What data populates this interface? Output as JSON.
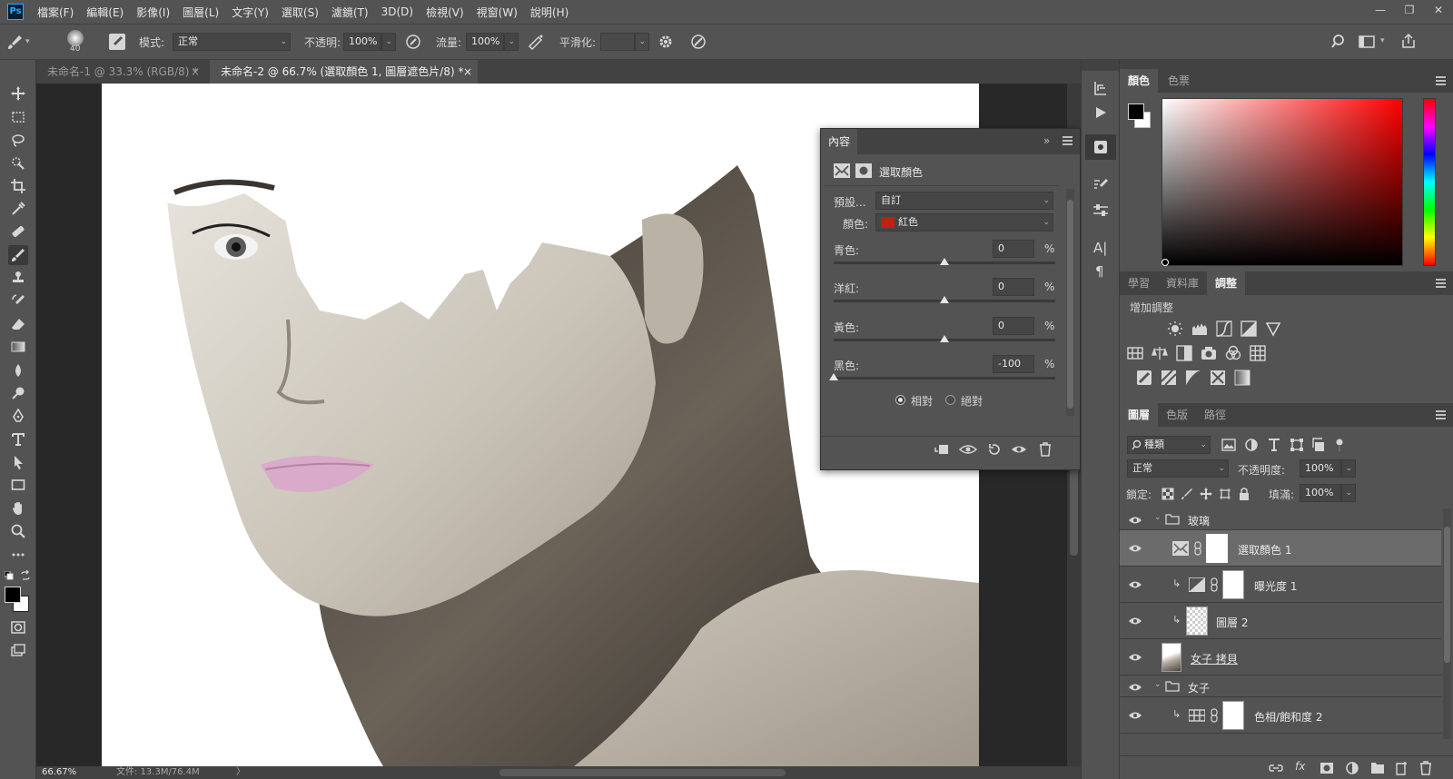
{
  "app": {
    "logo": "Ps"
  },
  "menu": {
    "items": [
      "檔案(F)",
      "編輯(E)",
      "影像(I)",
      "圖層(L)",
      "文字(Y)",
      "選取(S)",
      "濾鏡(T)",
      "3D(D)",
      "檢視(V)",
      "視窗(W)",
      "說明(H)"
    ]
  },
  "window": {
    "minimize": "—",
    "restore": "❐",
    "close": "✕"
  },
  "options": {
    "brush_size": "40",
    "mode_label": "模式:",
    "mode_value": "正常",
    "opacity_label": "不透明:",
    "opacity_value": "100%",
    "flow_label": "流量:",
    "flow_value": "100%",
    "smoothing_label": "平滑化:",
    "smoothing_value": ""
  },
  "tabs": [
    {
      "label": "未命名-1 @ 33.3% (RGB/8) *",
      "close": "×"
    },
    {
      "label": "未命名-2 @ 66.7% (選取顏色 1, 圖層遮色片/8) *",
      "close": "×"
    }
  ],
  "status": {
    "zoom": "66.67%",
    "doc": "文件: 13.3M/76.4M",
    "arrow": "〉"
  },
  "properties": {
    "title": "內容",
    "collapse": "»",
    "adj_title": "選取顏色",
    "preset_label": "預設...",
    "preset_value": "自訂",
    "colors_label": "顏色:",
    "colors_value": "紅色",
    "swatch": "#c0200f",
    "sliders": [
      {
        "label": "青色:",
        "value": "0",
        "fraction": 0.5
      },
      {
        "label": "洋紅:",
        "value": "0",
        "fraction": 0.5
      },
      {
        "label": "黃色:",
        "value": "0",
        "fraction": 0.5
      },
      {
        "label": "黑色:",
        "value": "-100",
        "fraction": 0.0
      }
    ],
    "percent": "%",
    "relative_label": "相對",
    "absolute_label": "絕對"
  },
  "color_panel": {
    "tabs": [
      "顏色",
      "色票"
    ],
    "fg": "#000000",
    "bg": "#ffffff"
  },
  "adjust_panel": {
    "tabs": [
      "學習",
      "資料庫",
      "調整"
    ],
    "heading": "增加調整"
  },
  "layers_panel": {
    "tabs": [
      "圖層",
      "色版",
      "路徑"
    ],
    "filter_value": "種類",
    "blend_value": "正常",
    "opacity_label": "不透明度:",
    "opacity_value": "100%",
    "lock_label": "鎖定:",
    "fill_label": "填滿:",
    "fill_value": "100%",
    "layers": [
      {
        "name": "玻璃",
        "kind": "group"
      },
      {
        "name": "選取顏色 1",
        "kind": "adjustment"
      },
      {
        "name": "曝光度 1",
        "kind": "adjustment"
      },
      {
        "name": "圖層 2",
        "kind": "pixel"
      },
      {
        "name": "女子 拷貝",
        "kind": "photo"
      },
      {
        "name": "女子",
        "kind": "group"
      },
      {
        "name": "色相/飽和度 2",
        "kind": "adjustment"
      }
    ],
    "footer": {
      "fx": "fx"
    }
  },
  "iconstrip": {
    "char": "A|",
    "para": "¶"
  }
}
